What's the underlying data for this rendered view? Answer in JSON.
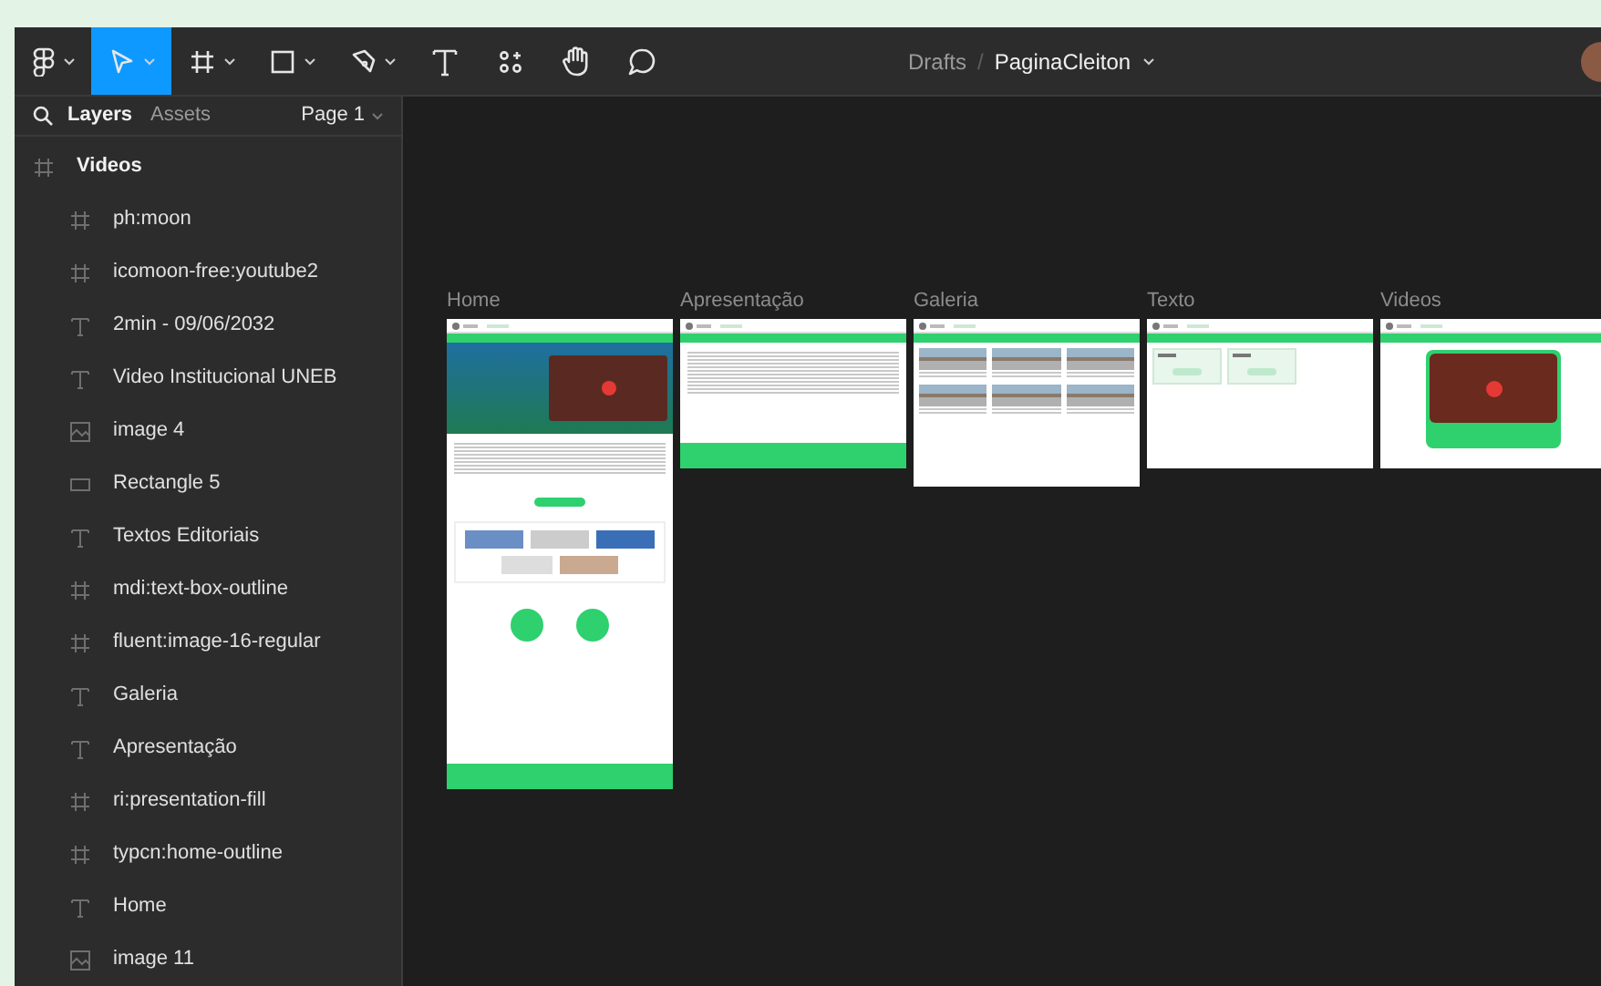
{
  "toolbar": {
    "tools": [
      {
        "kind": "main-menu",
        "selected": false
      },
      {
        "kind": "move",
        "selected": true
      },
      {
        "kind": "frame",
        "selected": false
      },
      {
        "kind": "shape",
        "selected": false
      },
      {
        "kind": "pen",
        "selected": false
      },
      {
        "kind": "text",
        "selected": false
      },
      {
        "kind": "resources",
        "selected": false
      },
      {
        "kind": "hand",
        "selected": false
      },
      {
        "kind": "comment",
        "selected": false
      }
    ],
    "breadcrumb": {
      "folder": "Drafts",
      "separator": "/",
      "file": "PaginaCleiton"
    }
  },
  "sidebar": {
    "tabs": [
      {
        "label": "Layers",
        "selected": true
      },
      {
        "label": "Assets",
        "selected": false
      }
    ],
    "page": "Page 1",
    "layers": [
      {
        "name": "Videos",
        "kind": "frame",
        "children": [
          {
            "name": "ph:moon",
            "kind": "frame"
          },
          {
            "name": "icomoon-free:youtube2",
            "kind": "frame"
          },
          {
            "name": "2min - 09/06/2032",
            "kind": "text"
          },
          {
            "name": "Video Institucional UNEB",
            "kind": "text"
          },
          {
            "name": "image 4",
            "kind": "image"
          },
          {
            "name": "Rectangle 5",
            "kind": "rectangle"
          },
          {
            "name": "Textos Editoriais",
            "kind": "text"
          },
          {
            "name": "mdi:text-box-outline",
            "kind": "frame"
          },
          {
            "name": "fluent:image-16-regular",
            "kind": "frame"
          },
          {
            "name": "Galeria",
            "kind": "text"
          },
          {
            "name": "Apresentação",
            "kind": "text"
          },
          {
            "name": "ri:presentation-fill",
            "kind": "frame"
          },
          {
            "name": "typcn:home-outline",
            "kind": "frame"
          },
          {
            "name": "Home",
            "kind": "text"
          },
          {
            "name": "image 11",
            "kind": "image"
          }
        ]
      }
    ]
  },
  "canvas": {
    "frames": [
      {
        "label": "Home",
        "kind": "home"
      },
      {
        "label": "Apresentação",
        "kind": "presentation"
      },
      {
        "label": "Galeria",
        "kind": "gallery"
      },
      {
        "label": "Texto",
        "kind": "text"
      },
      {
        "label": "Videos",
        "kind": "videos"
      }
    ]
  }
}
